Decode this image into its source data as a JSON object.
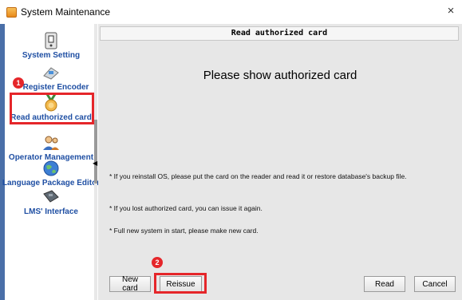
{
  "window": {
    "title": "System Maintenance",
    "close_glyph": "×"
  },
  "sidebar": {
    "items": [
      {
        "label": "System Setting",
        "icon": "settings-panel-icon"
      },
      {
        "label": "Register Encoder",
        "icon": "encoder-icon"
      },
      {
        "label": "Read authorized card",
        "icon": "medal-card-icon"
      },
      {
        "label": "Operator Management",
        "icon": "operator-icon"
      },
      {
        "label": "Language Package Editor",
        "icon": "globe-icon"
      },
      {
        "label": "LMS' Interface",
        "icon": "interface-icon"
      }
    ],
    "selected_index": 2
  },
  "panel": {
    "header": "Read authorized card",
    "prompt": "Please show  authorized card",
    "hints": [
      "* If you reinstall OS, please put the card on the reader and read it or restore database's backup file.",
      "* If you lost authorized card, you can issue it again.",
      "* Full new system in start, please make new card."
    ]
  },
  "buttons": {
    "new_card": "New card",
    "reissue": "Reissue",
    "read": "Read",
    "cancel": "Cancel"
  },
  "annotations": {
    "marker1": "1",
    "marker2": "2",
    "highlight_color": "#e5262a"
  }
}
